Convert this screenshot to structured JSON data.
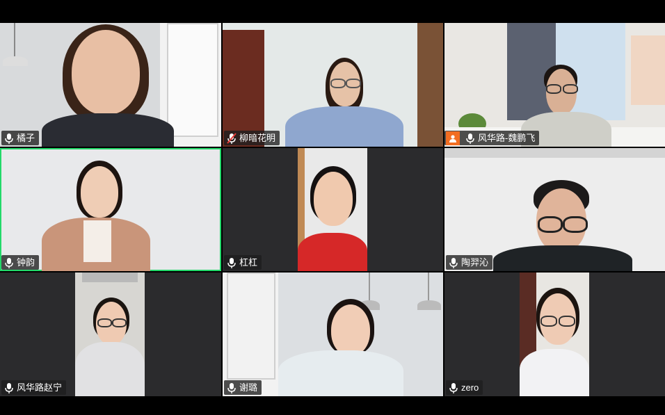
{
  "participants": [
    {
      "name": "橘子",
      "mic": "on"
    },
    {
      "name": "柳暗花明",
      "mic": "muted"
    },
    {
      "name": "风华路-魏鹏飞",
      "mic": "on",
      "host": true
    },
    {
      "name": "钟韵",
      "mic": "on",
      "active_speaker": true
    },
    {
      "name": "杠杠",
      "mic": "on"
    },
    {
      "name": "陶羿沁",
      "mic": "on"
    },
    {
      "name": "风华路赵宁",
      "mic": "on"
    },
    {
      "name": "谢璐",
      "mic": "on"
    },
    {
      "name": "zero",
      "mic": "on"
    }
  ],
  "colors": {
    "active_border": "#23d96a",
    "host_badge": "#f26d21",
    "muted_slash": "#e53935"
  },
  "icons": {
    "mic": "microphone-icon",
    "mic_muted": "microphone-muted-icon",
    "host": "person-badge-icon"
  }
}
